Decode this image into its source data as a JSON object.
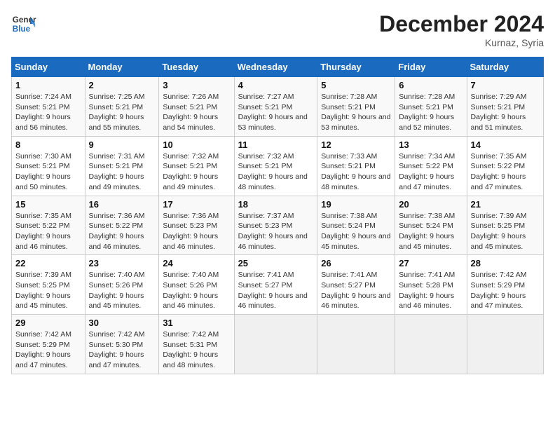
{
  "header": {
    "logo_line1": "General",
    "logo_line2": "Blue",
    "month_year": "December 2024",
    "location": "Kurnaz, Syria"
  },
  "weekdays": [
    "Sunday",
    "Monday",
    "Tuesday",
    "Wednesday",
    "Thursday",
    "Friday",
    "Saturday"
  ],
  "weeks": [
    [
      {
        "day": "1",
        "sunrise": "7:24 AM",
        "sunset": "5:21 PM",
        "daylight": "9 hours and 56 minutes."
      },
      {
        "day": "2",
        "sunrise": "7:25 AM",
        "sunset": "5:21 PM",
        "daylight": "9 hours and 55 minutes."
      },
      {
        "day": "3",
        "sunrise": "7:26 AM",
        "sunset": "5:21 PM",
        "daylight": "9 hours and 54 minutes."
      },
      {
        "day": "4",
        "sunrise": "7:27 AM",
        "sunset": "5:21 PM",
        "daylight": "9 hours and 53 minutes."
      },
      {
        "day": "5",
        "sunrise": "7:28 AM",
        "sunset": "5:21 PM",
        "daylight": "9 hours and 53 minutes."
      },
      {
        "day": "6",
        "sunrise": "7:28 AM",
        "sunset": "5:21 PM",
        "daylight": "9 hours and 52 minutes."
      },
      {
        "day": "7",
        "sunrise": "7:29 AM",
        "sunset": "5:21 PM",
        "daylight": "9 hours and 51 minutes."
      }
    ],
    [
      {
        "day": "8",
        "sunrise": "7:30 AM",
        "sunset": "5:21 PM",
        "daylight": "9 hours and 50 minutes."
      },
      {
        "day": "9",
        "sunrise": "7:31 AM",
        "sunset": "5:21 PM",
        "daylight": "9 hours and 49 minutes."
      },
      {
        "day": "10",
        "sunrise": "7:32 AM",
        "sunset": "5:21 PM",
        "daylight": "9 hours and 49 minutes."
      },
      {
        "day": "11",
        "sunrise": "7:32 AM",
        "sunset": "5:21 PM",
        "daylight": "9 hours and 48 minutes."
      },
      {
        "day": "12",
        "sunrise": "7:33 AM",
        "sunset": "5:21 PM",
        "daylight": "9 hours and 48 minutes."
      },
      {
        "day": "13",
        "sunrise": "7:34 AM",
        "sunset": "5:22 PM",
        "daylight": "9 hours and 47 minutes."
      },
      {
        "day": "14",
        "sunrise": "7:35 AM",
        "sunset": "5:22 PM",
        "daylight": "9 hours and 47 minutes."
      }
    ],
    [
      {
        "day": "15",
        "sunrise": "7:35 AM",
        "sunset": "5:22 PM",
        "daylight": "9 hours and 46 minutes."
      },
      {
        "day": "16",
        "sunrise": "7:36 AM",
        "sunset": "5:22 PM",
        "daylight": "9 hours and 46 minutes."
      },
      {
        "day": "17",
        "sunrise": "7:36 AM",
        "sunset": "5:23 PM",
        "daylight": "9 hours and 46 minutes."
      },
      {
        "day": "18",
        "sunrise": "7:37 AM",
        "sunset": "5:23 PM",
        "daylight": "9 hours and 46 minutes."
      },
      {
        "day": "19",
        "sunrise": "7:38 AM",
        "sunset": "5:24 PM",
        "daylight": "9 hours and 45 minutes."
      },
      {
        "day": "20",
        "sunrise": "7:38 AM",
        "sunset": "5:24 PM",
        "daylight": "9 hours and 45 minutes."
      },
      {
        "day": "21",
        "sunrise": "7:39 AM",
        "sunset": "5:25 PM",
        "daylight": "9 hours and 45 minutes."
      }
    ],
    [
      {
        "day": "22",
        "sunrise": "7:39 AM",
        "sunset": "5:25 PM",
        "daylight": "9 hours and 45 minutes."
      },
      {
        "day": "23",
        "sunrise": "7:40 AM",
        "sunset": "5:26 PM",
        "daylight": "9 hours and 45 minutes."
      },
      {
        "day": "24",
        "sunrise": "7:40 AM",
        "sunset": "5:26 PM",
        "daylight": "9 hours and 46 minutes."
      },
      {
        "day": "25",
        "sunrise": "7:41 AM",
        "sunset": "5:27 PM",
        "daylight": "9 hours and 46 minutes."
      },
      {
        "day": "26",
        "sunrise": "7:41 AM",
        "sunset": "5:27 PM",
        "daylight": "9 hours and 46 minutes."
      },
      {
        "day": "27",
        "sunrise": "7:41 AM",
        "sunset": "5:28 PM",
        "daylight": "9 hours and 46 minutes."
      },
      {
        "day": "28",
        "sunrise": "7:42 AM",
        "sunset": "5:29 PM",
        "daylight": "9 hours and 47 minutes."
      }
    ],
    [
      {
        "day": "29",
        "sunrise": "7:42 AM",
        "sunset": "5:29 PM",
        "daylight": "9 hours and 47 minutes."
      },
      {
        "day": "30",
        "sunrise": "7:42 AM",
        "sunset": "5:30 PM",
        "daylight": "9 hours and 47 minutes."
      },
      {
        "day": "31",
        "sunrise": "7:42 AM",
        "sunset": "5:31 PM",
        "daylight": "9 hours and 48 minutes."
      },
      null,
      null,
      null,
      null
    ]
  ],
  "labels": {
    "sunrise": "Sunrise:",
    "sunset": "Sunset:",
    "daylight": "Daylight:"
  }
}
